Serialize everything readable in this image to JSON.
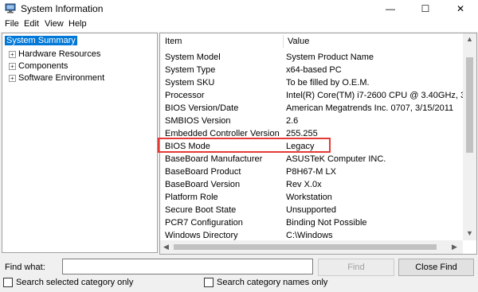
{
  "window": {
    "title": "System Information",
    "controls": [
      "—",
      "☐",
      "✕"
    ]
  },
  "menu": [
    "File",
    "Edit",
    "View",
    "Help"
  ],
  "tree": [
    {
      "label": "System Summary",
      "selected": true
    },
    {
      "label": "Hardware Resources",
      "expander": "+"
    },
    {
      "label": "Components",
      "expander": "+"
    },
    {
      "label": "Software Environment",
      "expander": "+"
    }
  ],
  "table": {
    "columns": [
      "Item",
      "Value"
    ],
    "rows": [
      [
        "System Model",
        "System Product Name"
      ],
      [
        "System Type",
        "x64-based PC"
      ],
      [
        "System SKU",
        "To be filled by O.E.M."
      ],
      [
        "Processor",
        "Intel(R) Core(TM) i7-2600 CPU @ 3.40GHz, 3401 M"
      ],
      [
        "BIOS Version/Date",
        "American Megatrends Inc. 0707, 3/15/2011"
      ],
      [
        "SMBIOS Version",
        "2.6"
      ],
      [
        "Embedded Controller Version",
        "255.255"
      ],
      [
        "BIOS Mode",
        "Legacy"
      ],
      [
        "BaseBoard Manufacturer",
        "ASUSTeK Computer INC."
      ],
      [
        "BaseBoard Product",
        "P8H67-M LX"
      ],
      [
        "BaseBoard Version",
        "Rev X.0x"
      ],
      [
        "Platform Role",
        "Workstation"
      ],
      [
        "Secure Boot State",
        "Unsupported"
      ],
      [
        "PCR7 Configuration",
        "Binding Not Possible"
      ],
      [
        "Windows Directory",
        "C:\\Windows"
      ]
    ]
  },
  "find": {
    "label": "Find what:",
    "value": "",
    "find_button": "Find",
    "close_button": "Close Find",
    "check1": "Search selected category only",
    "check2": "Search category names only"
  },
  "colors": {
    "selection": "#0078d7",
    "highlight_border": "#e53935"
  }
}
